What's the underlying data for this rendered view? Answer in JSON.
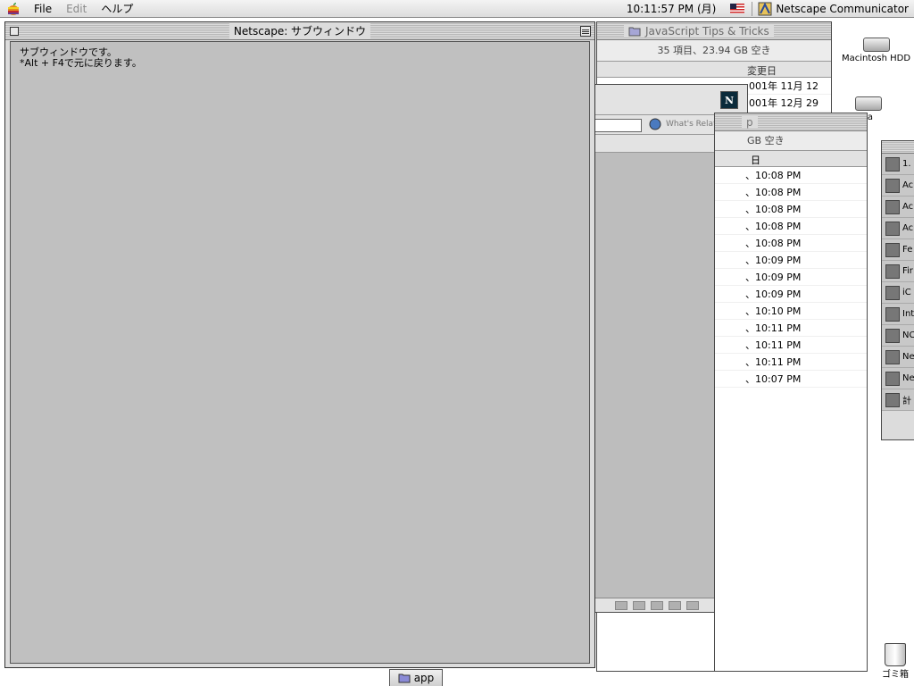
{
  "menubar": {
    "file": "File",
    "edit": "Edit",
    "help": "ヘルプ",
    "clock": "10:11:57 PM (月)",
    "app_name": "Netscape Communicator"
  },
  "finder_js": {
    "title": "JavaScript Tips & Tricks",
    "info": "35 項目、23.94 GB 空き",
    "header": "変更日",
    "rows": [
      "001年 11月 12",
      "001年 12月 29"
    ]
  },
  "netscape_back": {
    "related": "What's Related"
  },
  "finder_times": {
    "title": "p",
    "info": "GB 空き",
    "header": "日",
    "rows": [
      "、10:08 PM",
      "、10:08 PM",
      "、10:08 PM",
      "、10:08 PM",
      "、10:08 PM",
      "、10:09 PM",
      "、10:09 PM",
      "、10:09 PM",
      "、10:10 PM",
      "、10:11 PM",
      "、10:11 PM",
      "、10:11 PM",
      "、10:07 PM"
    ]
  },
  "launcher": {
    "items": [
      "1.",
      "Ac",
      "Ac",
      "Ac",
      "Fe",
      "Fir",
      "iC",
      "Int",
      "NC",
      "Ne",
      "Ne",
      "計"
    ]
  },
  "desktop": {
    "hdd": "Macintosh HDD",
    "drive2": "ta",
    "trash": "ゴミ箱"
  },
  "subwindow": {
    "title": "Netscape: サブウィンドウ",
    "line1": "サブウィンドウです。",
    "line2": "*Alt + F4で元に戻ります。"
  },
  "tab": {
    "label": "app"
  }
}
